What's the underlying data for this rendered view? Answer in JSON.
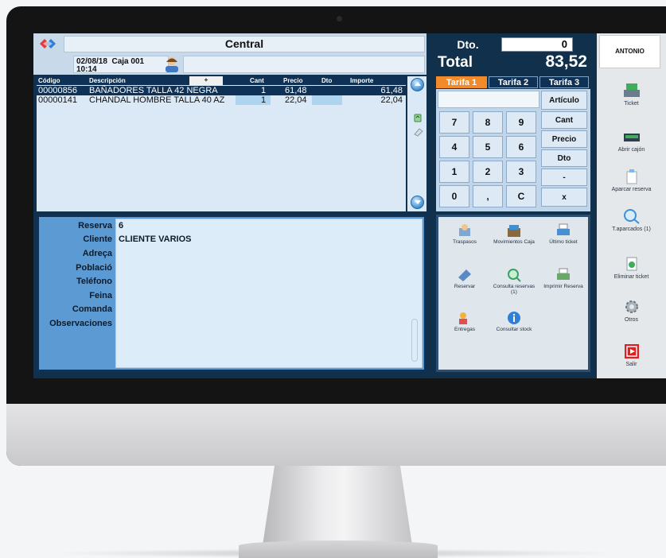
{
  "header": {
    "store": "Central",
    "date": "02/08/18",
    "caja": "Caja 001",
    "time": "10:14"
  },
  "table": {
    "columns": [
      "Código",
      "Descripción",
      "+",
      "Cant",
      "Precio",
      "Dto",
      "Importe"
    ],
    "rows": [
      {
        "code": "00000856",
        "desc": "BAÑADORES TALLA 42 NEGRA",
        "cant": "1",
        "precio": "61,48",
        "dto": "",
        "importe": "61,48"
      },
      {
        "code": "00000141",
        "desc": "CHANDAL HOMBRE TALLA 40 AZ",
        "cant": "1",
        "precio": "22,04",
        "dto": "",
        "importe": "22,04"
      }
    ]
  },
  "form": {
    "labels": [
      "Reserva",
      "Cliente",
      "Adreça",
      "Població",
      "Teléfono",
      "Feina",
      "Comanda",
      "Observaciones"
    ],
    "reserva": "6",
    "cliente": "CLIENTE VARIOS"
  },
  "totals": {
    "dto_label": "Dto.",
    "dto_value": "0",
    "total_label": "Total",
    "total_value": "83,52"
  },
  "tarifas": [
    "Tarifa 1",
    "Tarifa 2",
    "Tarifa 3"
  ],
  "keypad": {
    "digits": [
      "7",
      "8",
      "9",
      "4",
      "5",
      "6",
      "1",
      "2",
      "3",
      "0",
      ",",
      "C"
    ],
    "functions": [
      "Artículo",
      "Cant",
      "Precio",
      "Dto",
      "-",
      "x"
    ]
  },
  "actions": [
    "Traspasos",
    "Movimientos Caja",
    "Último ticket",
    "Reservar",
    "Consulta reservas (1)",
    "Imprimir Reserva",
    "Entregas",
    "Consultar stock"
  ],
  "sidebar": {
    "user": "ANTONIO",
    "items": [
      "Ticket",
      "Abrir cajón",
      "Aparcar reserva",
      "T.aparcados (1)",
      "Eliminar ticket",
      "Otros",
      "Salir"
    ]
  },
  "colors": {
    "navy": "#0f3155",
    "accent_orange": "#f08a2a",
    "form_blue": "#5b9ad3"
  }
}
